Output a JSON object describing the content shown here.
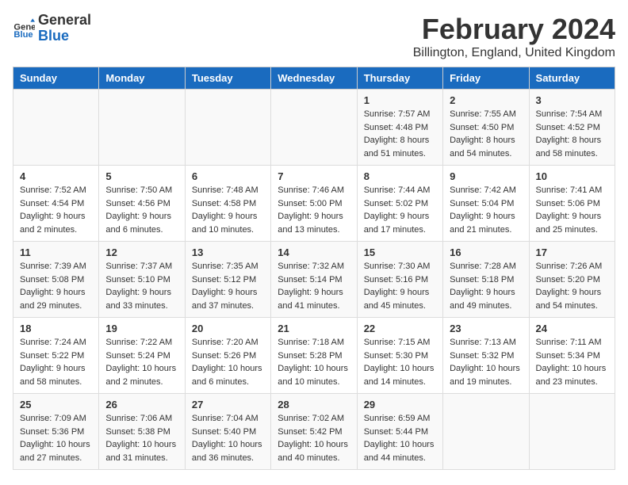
{
  "header": {
    "logo_line1": "General",
    "logo_line2": "Blue",
    "title": "February 2024",
    "subtitle": "Billington, England, United Kingdom"
  },
  "days_of_week": [
    "Sunday",
    "Monday",
    "Tuesday",
    "Wednesday",
    "Thursday",
    "Friday",
    "Saturday"
  ],
  "weeks": [
    [
      {
        "day": "",
        "info": ""
      },
      {
        "day": "",
        "info": ""
      },
      {
        "day": "",
        "info": ""
      },
      {
        "day": "",
        "info": ""
      },
      {
        "day": "1",
        "info": "Sunrise: 7:57 AM\nSunset: 4:48 PM\nDaylight: 8 hours\nand 51 minutes."
      },
      {
        "day": "2",
        "info": "Sunrise: 7:55 AM\nSunset: 4:50 PM\nDaylight: 8 hours\nand 54 minutes."
      },
      {
        "day": "3",
        "info": "Sunrise: 7:54 AM\nSunset: 4:52 PM\nDaylight: 8 hours\nand 58 minutes."
      }
    ],
    [
      {
        "day": "4",
        "info": "Sunrise: 7:52 AM\nSunset: 4:54 PM\nDaylight: 9 hours\nand 2 minutes."
      },
      {
        "day": "5",
        "info": "Sunrise: 7:50 AM\nSunset: 4:56 PM\nDaylight: 9 hours\nand 6 minutes."
      },
      {
        "day": "6",
        "info": "Sunrise: 7:48 AM\nSunset: 4:58 PM\nDaylight: 9 hours\nand 10 minutes."
      },
      {
        "day": "7",
        "info": "Sunrise: 7:46 AM\nSunset: 5:00 PM\nDaylight: 9 hours\nand 13 minutes."
      },
      {
        "day": "8",
        "info": "Sunrise: 7:44 AM\nSunset: 5:02 PM\nDaylight: 9 hours\nand 17 minutes."
      },
      {
        "day": "9",
        "info": "Sunrise: 7:42 AM\nSunset: 5:04 PM\nDaylight: 9 hours\nand 21 minutes."
      },
      {
        "day": "10",
        "info": "Sunrise: 7:41 AM\nSunset: 5:06 PM\nDaylight: 9 hours\nand 25 minutes."
      }
    ],
    [
      {
        "day": "11",
        "info": "Sunrise: 7:39 AM\nSunset: 5:08 PM\nDaylight: 9 hours\nand 29 minutes."
      },
      {
        "day": "12",
        "info": "Sunrise: 7:37 AM\nSunset: 5:10 PM\nDaylight: 9 hours\nand 33 minutes."
      },
      {
        "day": "13",
        "info": "Sunrise: 7:35 AM\nSunset: 5:12 PM\nDaylight: 9 hours\nand 37 minutes."
      },
      {
        "day": "14",
        "info": "Sunrise: 7:32 AM\nSunset: 5:14 PM\nDaylight: 9 hours\nand 41 minutes."
      },
      {
        "day": "15",
        "info": "Sunrise: 7:30 AM\nSunset: 5:16 PM\nDaylight: 9 hours\nand 45 minutes."
      },
      {
        "day": "16",
        "info": "Sunrise: 7:28 AM\nSunset: 5:18 PM\nDaylight: 9 hours\nand 49 minutes."
      },
      {
        "day": "17",
        "info": "Sunrise: 7:26 AM\nSunset: 5:20 PM\nDaylight: 9 hours\nand 54 minutes."
      }
    ],
    [
      {
        "day": "18",
        "info": "Sunrise: 7:24 AM\nSunset: 5:22 PM\nDaylight: 9 hours\nand 58 minutes."
      },
      {
        "day": "19",
        "info": "Sunrise: 7:22 AM\nSunset: 5:24 PM\nDaylight: 10 hours\nand 2 minutes."
      },
      {
        "day": "20",
        "info": "Sunrise: 7:20 AM\nSunset: 5:26 PM\nDaylight: 10 hours\nand 6 minutes."
      },
      {
        "day": "21",
        "info": "Sunrise: 7:18 AM\nSunset: 5:28 PM\nDaylight: 10 hours\nand 10 minutes."
      },
      {
        "day": "22",
        "info": "Sunrise: 7:15 AM\nSunset: 5:30 PM\nDaylight: 10 hours\nand 14 minutes."
      },
      {
        "day": "23",
        "info": "Sunrise: 7:13 AM\nSunset: 5:32 PM\nDaylight: 10 hours\nand 19 minutes."
      },
      {
        "day": "24",
        "info": "Sunrise: 7:11 AM\nSunset: 5:34 PM\nDaylight: 10 hours\nand 23 minutes."
      }
    ],
    [
      {
        "day": "25",
        "info": "Sunrise: 7:09 AM\nSunset: 5:36 PM\nDaylight: 10 hours\nand 27 minutes."
      },
      {
        "day": "26",
        "info": "Sunrise: 7:06 AM\nSunset: 5:38 PM\nDaylight: 10 hours\nand 31 minutes."
      },
      {
        "day": "27",
        "info": "Sunrise: 7:04 AM\nSunset: 5:40 PM\nDaylight: 10 hours\nand 36 minutes."
      },
      {
        "day": "28",
        "info": "Sunrise: 7:02 AM\nSunset: 5:42 PM\nDaylight: 10 hours\nand 40 minutes."
      },
      {
        "day": "29",
        "info": "Sunrise: 6:59 AM\nSunset: 5:44 PM\nDaylight: 10 hours\nand 44 minutes."
      },
      {
        "day": "",
        "info": ""
      },
      {
        "day": "",
        "info": ""
      }
    ]
  ]
}
